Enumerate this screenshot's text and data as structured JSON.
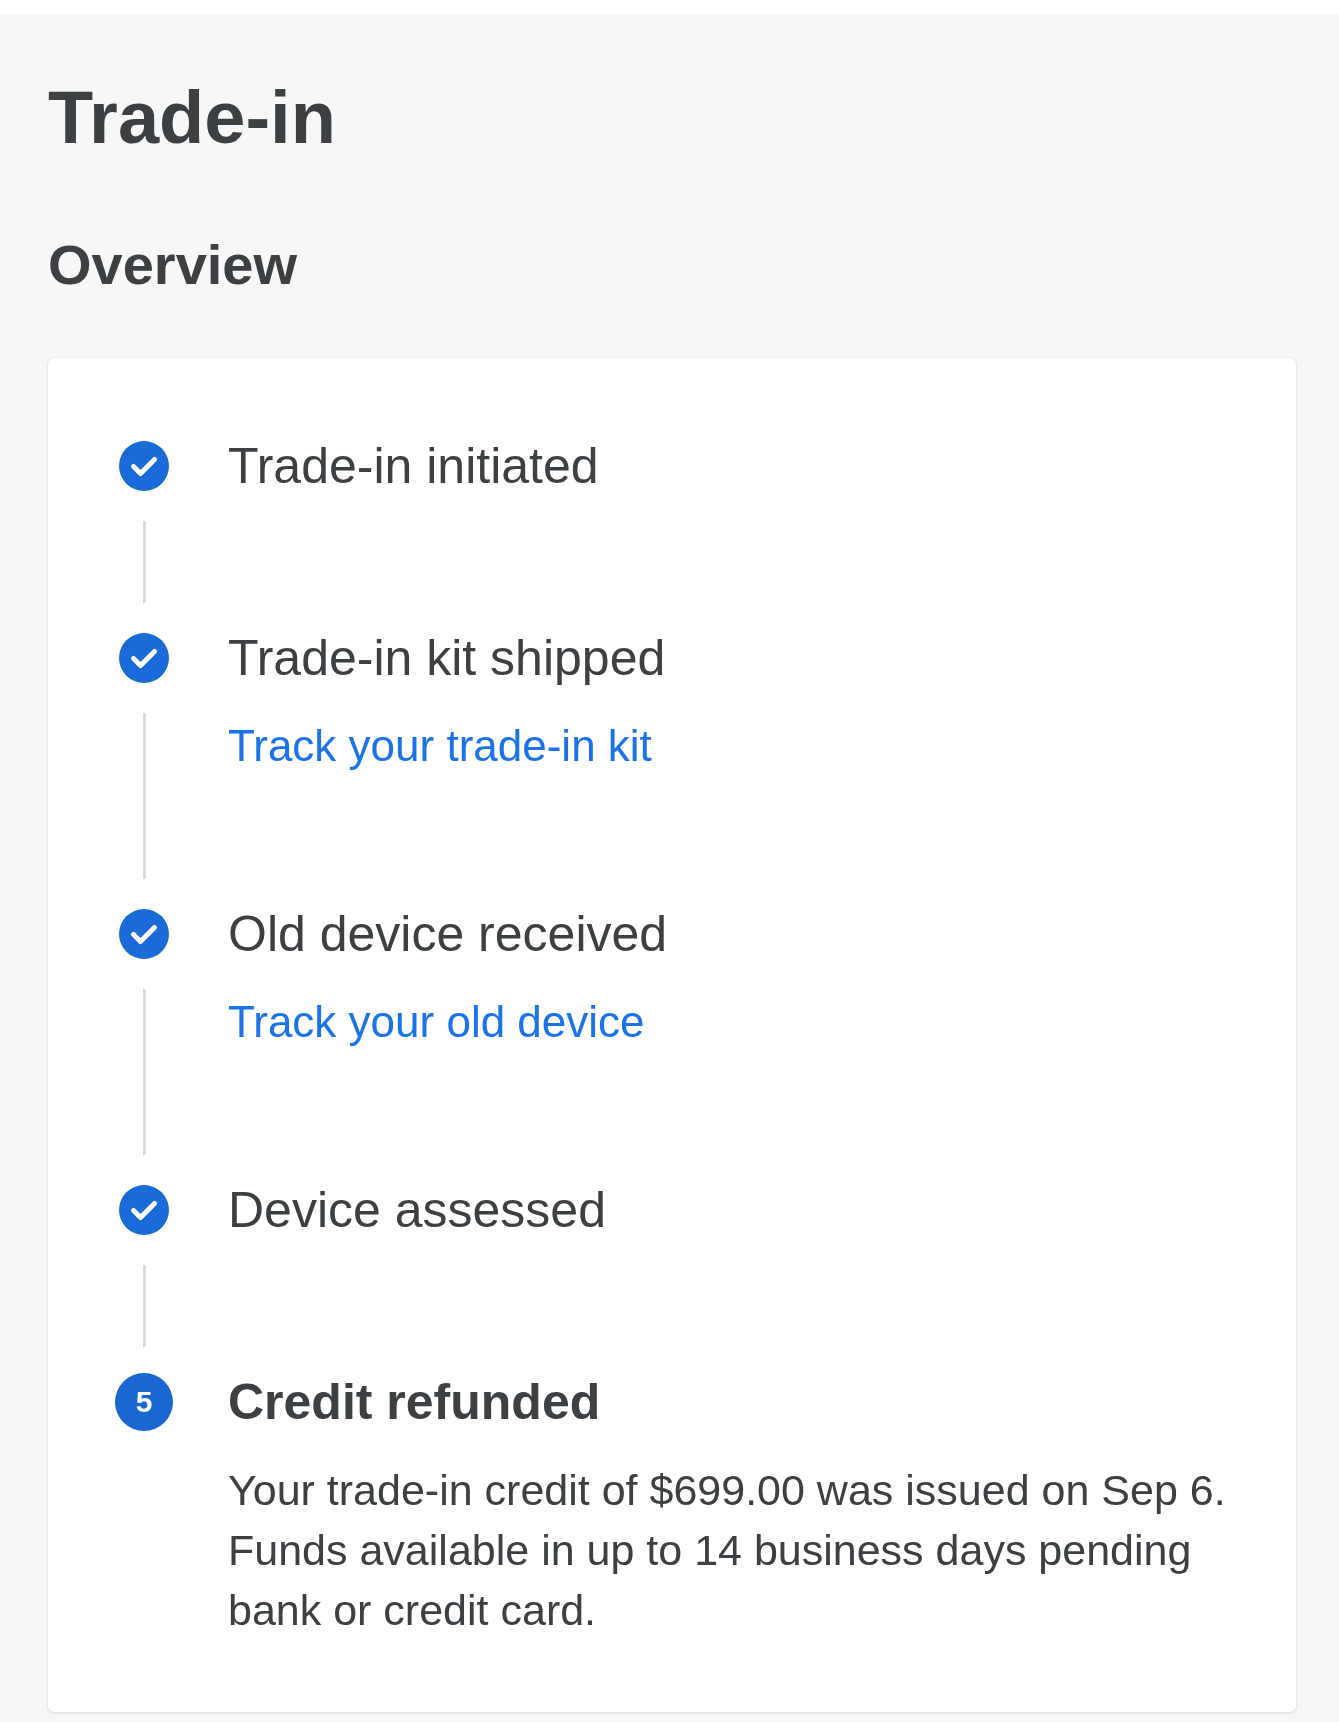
{
  "page": {
    "title": "Trade-in"
  },
  "overview": {
    "heading": "Overview",
    "steps": [
      {
        "title": "Trade-in initiated",
        "completed": true
      },
      {
        "title": "Trade-in kit shipped",
        "completed": true,
        "link": "Track your trade-in kit"
      },
      {
        "title": "Old device received",
        "completed": true,
        "link": "Track your old device"
      },
      {
        "title": "Device assessed",
        "completed": true
      },
      {
        "title": "Credit refunded",
        "completed": false,
        "number": "5",
        "description": "Your trade-in credit of $699.00 was issued on Sep 6. Funds available in up to 14 business days pending bank or credit card."
      }
    ]
  }
}
